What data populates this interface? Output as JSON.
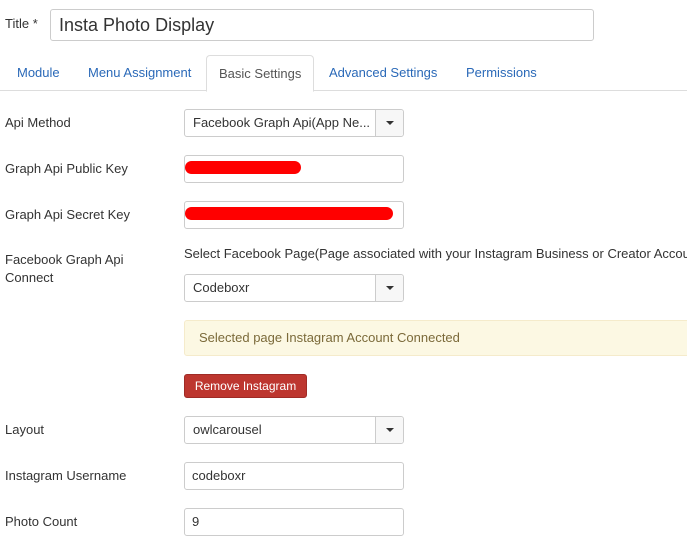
{
  "title_field": {
    "label": "Title *",
    "value": "Insta Photo Display"
  },
  "tabs": [
    {
      "label": "Module"
    },
    {
      "label": "Menu Assignment"
    },
    {
      "label": "Basic Settings"
    },
    {
      "label": "Advanced Settings"
    },
    {
      "label": "Permissions"
    }
  ],
  "active_tab": "Basic Settings",
  "fields": {
    "api_method": {
      "label": "Api Method",
      "value": "Facebook Graph Api(App Ne..."
    },
    "public_key": {
      "label": "Graph Api Public Key"
    },
    "secret_key": {
      "label": "Graph Api Secret Key"
    },
    "fb_connect": {
      "label_line1": "Facebook Graph Api",
      "label_line2": "Connect",
      "instruction": "Select Facebook Page(Page associated with your Instagram Business or Creator Accou",
      "page_value": "Codeboxr",
      "alert": "Selected page Instagram Account Connected",
      "remove_button": "Remove Instagram"
    },
    "layout": {
      "label": "Layout",
      "value": "owlcarousel"
    },
    "username": {
      "label": "Instagram Username",
      "value": "codeboxr"
    },
    "photo_count": {
      "label": "Photo Count",
      "value": "9"
    }
  },
  "colors": {
    "link": "#2a69b8",
    "danger": "#bd362f",
    "alert_bg": "#fcf8e3",
    "redaction": "#ff0000"
  }
}
